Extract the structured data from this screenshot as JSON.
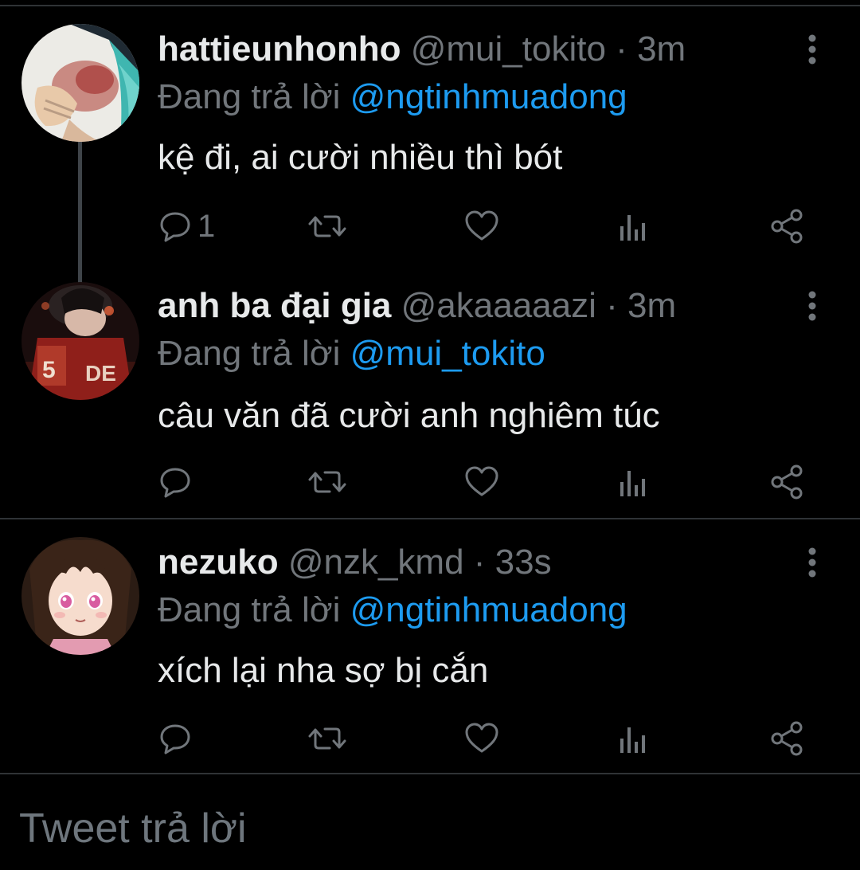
{
  "colors": {
    "background": "#000000",
    "text": "#e7e9ea",
    "muted": "#71767b",
    "mention": "#1d9bf0",
    "divider": "#2f3336"
  },
  "tweets": [
    {
      "display_name": "hattieunhonho",
      "handle": "@mui_tokito",
      "separator": "·",
      "time": "3m",
      "reply_prefix": "Đang trả lời",
      "reply_to": "@ngtinhmuadong",
      "text": "kệ đi, ai cười nhiều thì bót",
      "reply_count": "1",
      "avatar_icon": "avatar-anime-boy-teal-hair"
    },
    {
      "display_name": "anh ba đại gia",
      "handle": "@akaaaaazi",
      "separator": "·",
      "time": "3m",
      "reply_prefix": "Đang trả lời",
      "reply_to": "@mui_tokito",
      "text": "câu văn đã cười anh nghiêm túc",
      "reply_count": "",
      "avatar_icon": "avatar-anime-dark-red"
    },
    {
      "display_name": "nezuko",
      "handle": "@nzk_kmd",
      "separator": "·",
      "time": "33s",
      "reply_prefix": "Đang trả lời",
      "reply_to": "@ngtinhmuadong",
      "text": "xích lại nha sợ bị cắn",
      "reply_count": "",
      "avatar_icon": "avatar-anime-girl-pink-eyes"
    }
  ],
  "icons": {
    "more": "more-vertical-icon",
    "reply": "reply-bubble-icon",
    "retweet": "retweet-icon",
    "like": "heart-icon",
    "views": "analytics-bar-icon",
    "share": "share-icon"
  },
  "composer": {
    "placeholder": "Tweet trả lời"
  }
}
